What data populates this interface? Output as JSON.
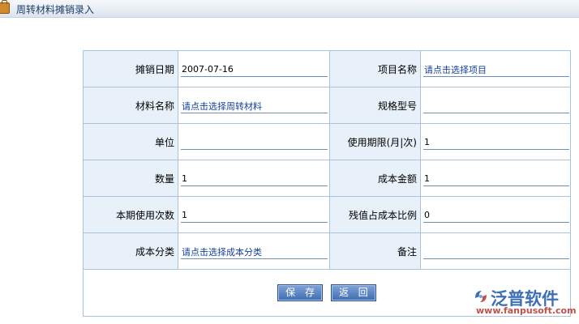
{
  "window": {
    "title": "周转材料摊销录入"
  },
  "form": {
    "rows": [
      {
        "left": {
          "label": "摊销日期",
          "value": "2007-07-16"
        },
        "right": {
          "label": "项目名称",
          "value": "请点击选择项目"
        }
      },
      {
        "left": {
          "label": "材料名称",
          "value": "请点击选择周转材料"
        },
        "right": {
          "label": "规格型号",
          "value": ""
        }
      },
      {
        "left": {
          "label": "单位",
          "value": ""
        },
        "right": {
          "label": "使用期限(月|次)",
          "value": "1"
        }
      },
      {
        "left": {
          "label": "数量",
          "value": "1"
        },
        "right": {
          "label": "成本金额",
          "value": "1"
        }
      },
      {
        "left": {
          "label": "本期使用次数",
          "value": "1"
        },
        "right": {
          "label": "残值占成本比例",
          "value": "0"
        }
      },
      {
        "left": {
          "label": "成本分类",
          "value": "请点击选择成本分类"
        },
        "right": {
          "label": "备注",
          "value": ""
        }
      }
    ]
  },
  "buttons": {
    "save": "保 存",
    "back": "返 回"
  },
  "watermark": {
    "brand": "泛普软件",
    "url": "www.fanpusoft.com"
  },
  "colors": {
    "label_bg": "#e8f0f9",
    "border": "#a9c3dd",
    "button": "#4a76b8",
    "link": "#14409a"
  }
}
